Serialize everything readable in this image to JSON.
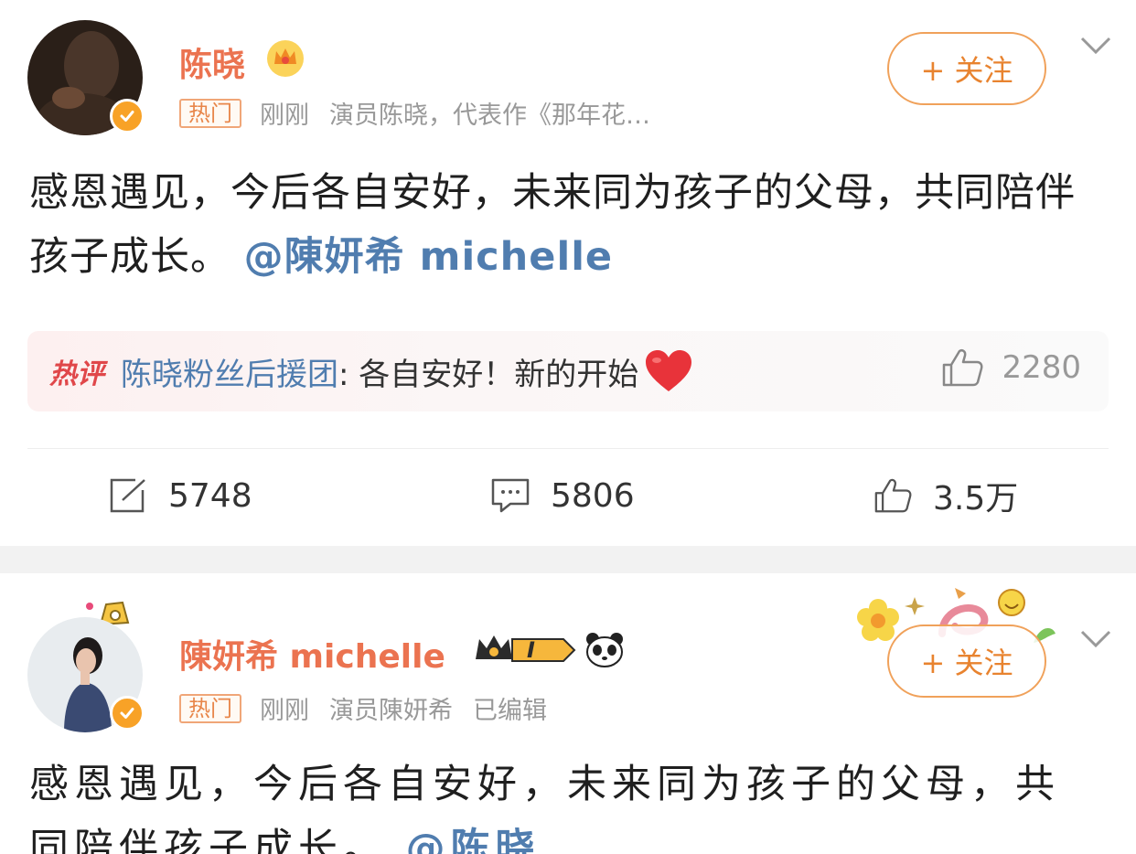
{
  "post1": {
    "author": {
      "name": "陈晓"
    },
    "meta": {
      "hot_tag": "热门",
      "time": "刚刚",
      "description": "演员陈晓，代表作《那年花…"
    },
    "follow_label": "+ 关注",
    "content": {
      "text": "感恩遇见，今后各自安好，未来同为孩子的父母，共同陪伴孩子成长。",
      "mention": "@陳妍希 michelle"
    },
    "hot_comment": {
      "label": "热评",
      "user": "陈晓粉丝后援团",
      "text": ": 各自安好！新的开始",
      "likes": "2280"
    },
    "actions": {
      "reposts": "5748",
      "comments": "5806",
      "likes": "3.5万"
    }
  },
  "post2": {
    "author": {
      "name": "陳妍希 michelle",
      "level_badge": "I"
    },
    "meta": {
      "hot_tag": "热门",
      "time": "刚刚",
      "description": "演员陳妍希",
      "edited": "已编辑"
    },
    "follow_label": "+ 关注",
    "content": {
      "text": "感恩遇见，今后各自安好，未来同为孩子的父母，共同陪伴孩子成长。",
      "mention": "@陈晓"
    }
  },
  "colors": {
    "accent_orange": "#eb7350",
    "link_blue": "#507daf",
    "hot_red": "#e0474a"
  }
}
